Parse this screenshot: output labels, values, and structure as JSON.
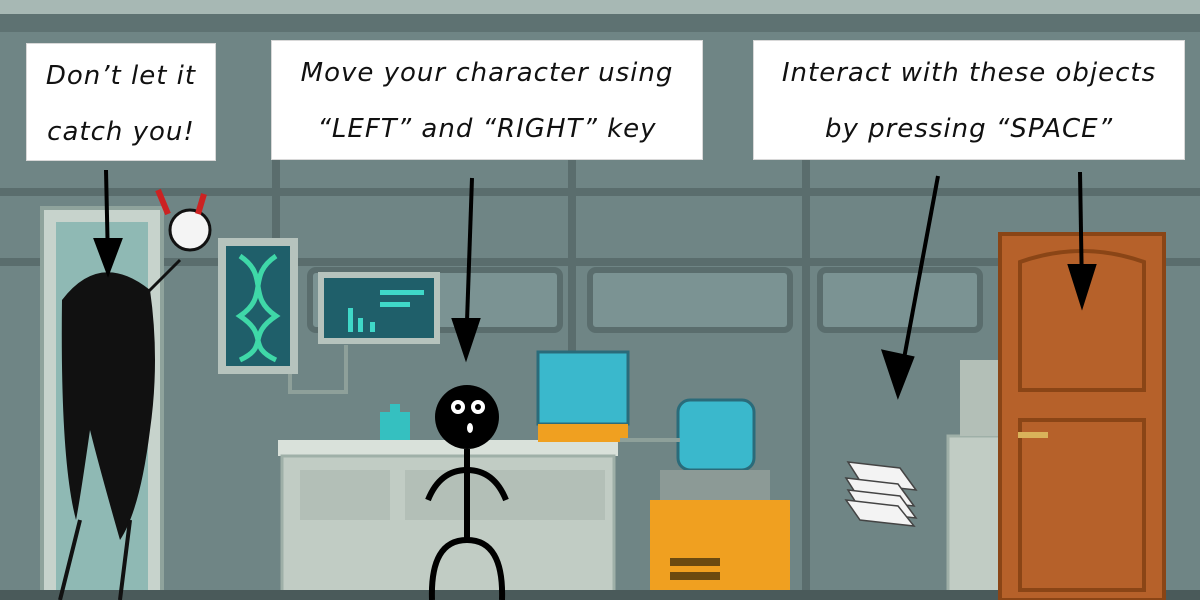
{
  "tutorial": {
    "catch": {
      "line1": "Don’t let it",
      "line2": "catch you!"
    },
    "move": {
      "line1": "Move your character using",
      "line2": "“LEFT” and “RIGHT” key"
    },
    "interact": {
      "line1": "Interact with these objects",
      "line2": "by pressing “SPACE”"
    }
  },
  "colors": {
    "wall": "#6f8585",
    "panel": "#7d9595",
    "trim": "#5a6d6d",
    "screen": "#2a8c8c",
    "screen_glow": "#3fd8c8",
    "counter": "#c9d3cc",
    "door": "#b6612a",
    "machine": "#f0a020"
  }
}
